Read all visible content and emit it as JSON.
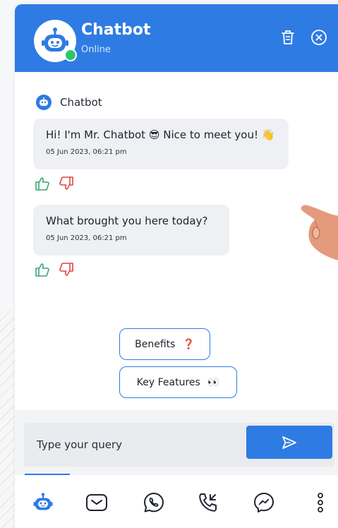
{
  "colors": {
    "primary": "#2e7be4",
    "online": "#2ec56d",
    "like": "#3aa676",
    "dislike": "#e04545"
  },
  "header": {
    "title": "Chatbot",
    "status": "Online",
    "icons": [
      "trash-icon",
      "close-circle-icon"
    ]
  },
  "conversation": {
    "sender_name": "Chatbot",
    "messages": [
      {
        "text": "Hi! I'm Mr. Chatbot 😎 Nice to meet you! 👋",
        "time": "05 Jun 2023, 06:21 pm"
      },
      {
        "text": "What brought you here today?",
        "time": "05 Jun 2023, 06:21 pm"
      }
    ]
  },
  "quick_replies": [
    {
      "label": "Benefits",
      "emoji": "❓"
    },
    {
      "label": "Key Features",
      "emoji": "👀"
    }
  ],
  "composer": {
    "placeholder": "Type your query"
  },
  "bottom_nav": {
    "items": [
      "chatbot-icon",
      "email-icon",
      "whatsapp-icon",
      "phone-icon",
      "messenger-icon",
      "more-icon"
    ],
    "active": "chatbot-icon"
  }
}
